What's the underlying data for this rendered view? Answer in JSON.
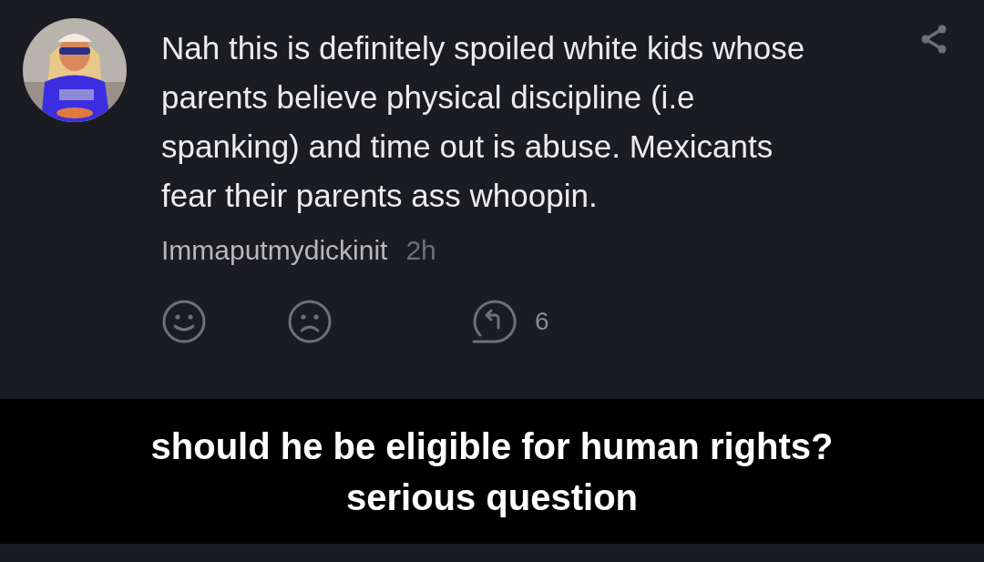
{
  "comment": {
    "text": "Nah this is definitely spoiled white kids whose parents believe physical discipline (i.e spanking) and time out is abuse. Mexicants fear their parents ass whoopin.",
    "username": "Immaputmydickinit",
    "time": "2h",
    "reply_count": "6"
  },
  "caption": {
    "lines": [
      "should he be eligible for human rights?",
      "serious question"
    ]
  }
}
